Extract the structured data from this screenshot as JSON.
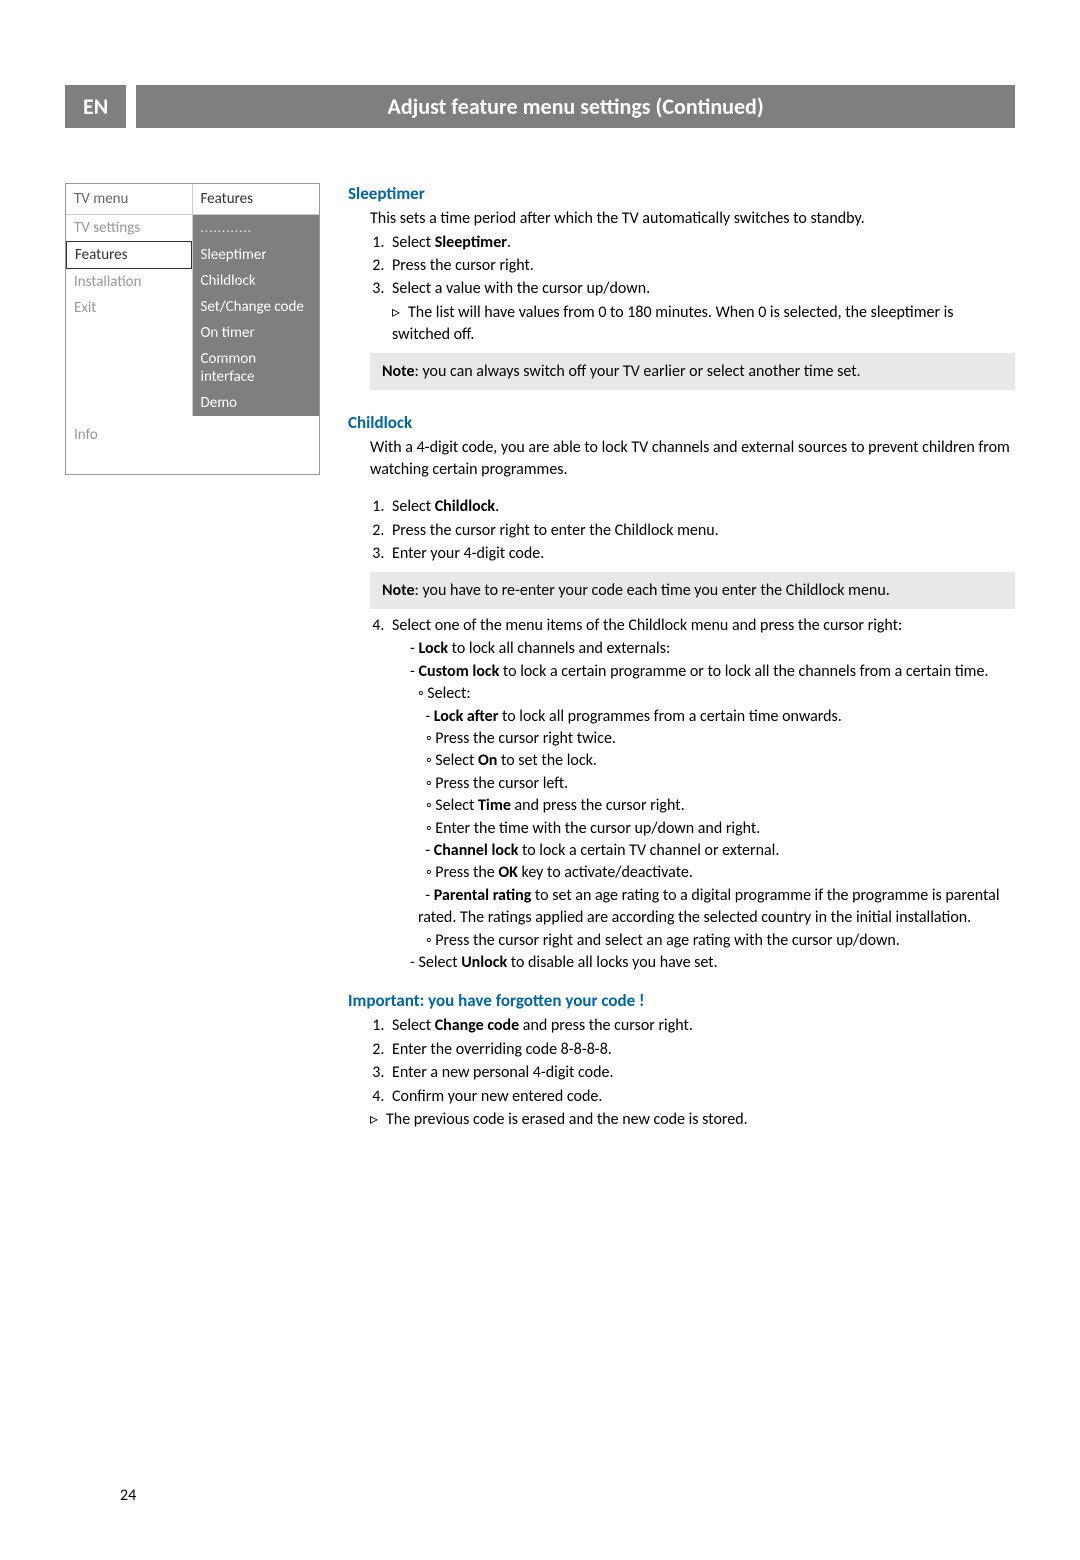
{
  "header": {
    "lang": "EN",
    "title": "Adjust feature menu settings  (Continued)"
  },
  "menu": {
    "left_header": "TV menu",
    "right_header": "Features",
    "left_items": [
      "TV settings",
      "Features",
      "Installation",
      "Exit"
    ],
    "selected_left": "Features",
    "right_dotted": "............",
    "right_items": [
      "Sleeptimer",
      "Childlock",
      "Set/Change code",
      "On timer",
      "Common interface",
      "Demo"
    ],
    "info": "Info"
  },
  "sleeptimer": {
    "title": "Sleeptimer",
    "intro": "This sets a time period after which the TV automatically switches to standby.",
    "step1_a": "Select ",
    "step1_b": "Sleeptimer",
    "step1_c": ".",
    "step2": "Press the cursor right.",
    "step3": "Select a value with the cursor up/down.",
    "sub": "The list will have values from 0 to 180 minutes. When 0 is selected, the sleeptimer is switched off.",
    "note_b": "Note",
    "note_t": ": you can always switch off your TV earlier or select another time set."
  },
  "childlock": {
    "title": "Childlock",
    "intro": "With a 4-digit code, you are able to lock TV channels and external sources to prevent children from watching certain programmes.",
    "s1a": "Select ",
    "s1b": "Childlock",
    "s1c": ".",
    "s2": "Press the cursor right to enter the Childlock menu.",
    "s3": "Enter your 4-digit code.",
    "note_b": "Note",
    "note_t": ": you have to re-enter your code each time you enter the Childlock menu.",
    "s4": "Select one of the menu items of the Childlock menu and press the cursor right:",
    "d1a": "Lock",
    "d1b": " to lock all channels and externals:",
    "d2a": "Custom lock",
    "d2b": " to lock a certain programme or to lock all the channels from a certain time.",
    "c_select": "Select:",
    "d3a": "Lock after",
    "d3b": " to lock all programmes from a certain time onwards.",
    "c3_1": "Press the cursor right twice.",
    "c3_2a": "Select ",
    "c3_2b": "On",
    "c3_2c": " to set the lock.",
    "c3_3": "Press the cursor left.",
    "c3_4a": "Select ",
    "c3_4b": "Time",
    "c3_4c": " and press the cursor right.",
    "c3_5": "Enter the time with the cursor up/down and right.",
    "d4a": "Channel lock",
    "d4b": " to lock a certain TV channel or external.",
    "c4_1a": "Press the ",
    "c4_1b": "OK",
    "c4_1c": " key to activate/deactivate.",
    "d5a": "Parental rating",
    "d5b": " to set an age rating to a digital programme if the programme is parental rated. The ratings applied are according the selected country in the initial installation.",
    "c5_1": "Press the cursor right and select an age rating with the cursor up/down.",
    "d6a": "- Select ",
    "d6b": "Unlock",
    "d6c": " to disable all locks you have set."
  },
  "forgot": {
    "title": "Important: you have forgotten your code !",
    "s1a": "Select ",
    "s1b": "Change code",
    "s1c": " and press the cursor right.",
    "s2": "Enter the overriding code 8-8-8-8.",
    "s3": "Enter a new personal 4-digit code.",
    "s4": "Confirm your new entered code.",
    "sub": "The previous code is erased and the new code is stored."
  },
  "page": "24"
}
